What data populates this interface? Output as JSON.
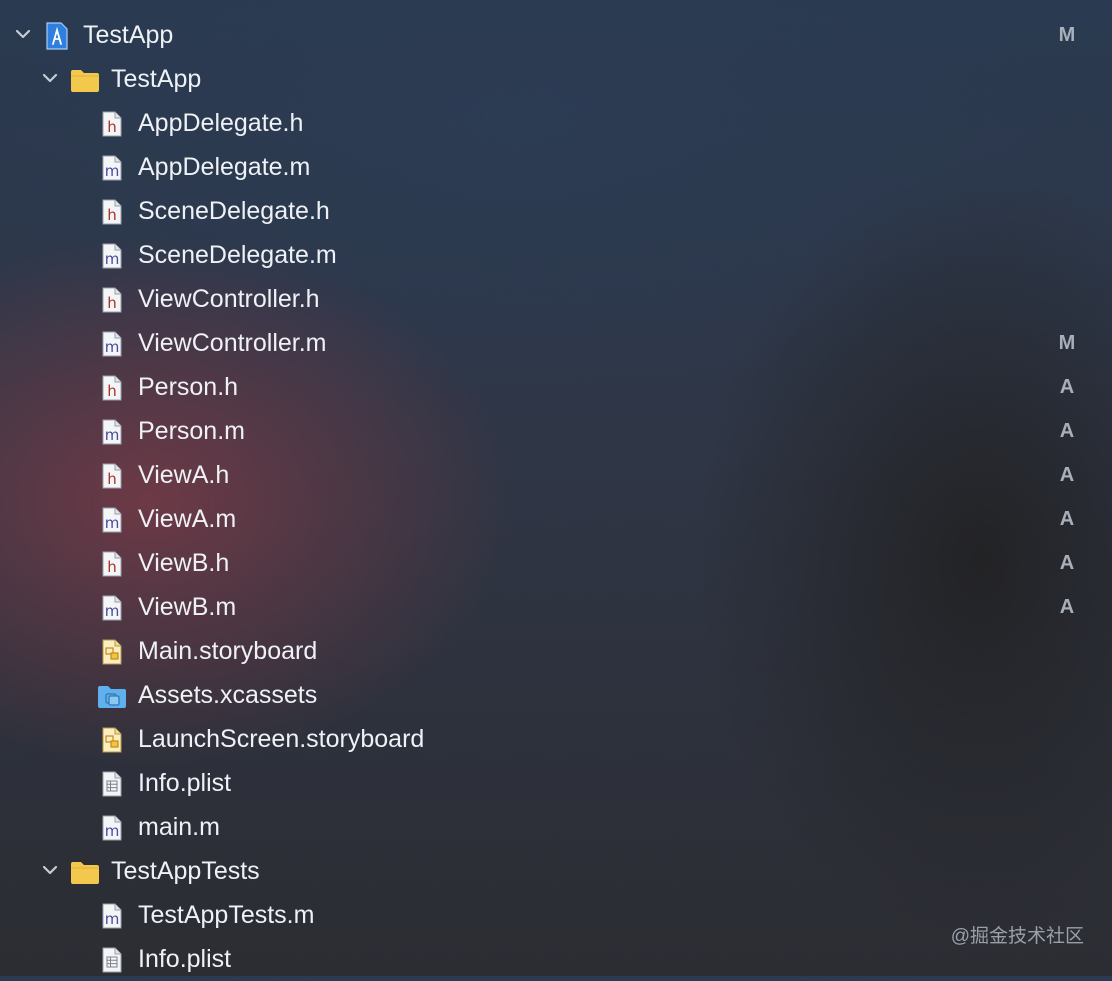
{
  "project": {
    "name": "TestApp",
    "status": "M"
  },
  "groups": [
    {
      "name": "TestApp",
      "files": [
        {
          "name": "AppDelegate.h",
          "icon": "h-header-file-icon",
          "status": ""
        },
        {
          "name": "AppDelegate.m",
          "icon": "m-source-file-icon",
          "status": ""
        },
        {
          "name": "SceneDelegate.h",
          "icon": "h-header-file-icon",
          "status": ""
        },
        {
          "name": "SceneDelegate.m",
          "icon": "m-source-file-icon",
          "status": ""
        },
        {
          "name": "ViewController.h",
          "icon": "h-header-file-icon",
          "status": ""
        },
        {
          "name": "ViewController.m",
          "icon": "m-source-file-icon",
          "status": "M"
        },
        {
          "name": "Person.h",
          "icon": "h-header-file-icon",
          "status": "A"
        },
        {
          "name": "Person.m",
          "icon": "m-source-file-icon",
          "status": "A"
        },
        {
          "name": "ViewA.h",
          "icon": "h-header-file-icon",
          "status": "A"
        },
        {
          "name": "ViewA.m",
          "icon": "m-source-file-icon",
          "status": "A"
        },
        {
          "name": "ViewB.h",
          "icon": "h-header-file-icon",
          "status": "A"
        },
        {
          "name": "ViewB.m",
          "icon": "m-source-file-icon",
          "status": "A"
        },
        {
          "name": "Main.storyboard",
          "icon": "storyboard-file-icon",
          "status": ""
        },
        {
          "name": "Assets.xcassets",
          "icon": "asset-catalog-folder-icon",
          "status": ""
        },
        {
          "name": "LaunchScreen.storyboard",
          "icon": "storyboard-file-icon",
          "status": ""
        },
        {
          "name": "Info.plist",
          "icon": "plist-file-icon",
          "status": ""
        },
        {
          "name": "main.m",
          "icon": "m-source-file-icon",
          "status": ""
        }
      ]
    },
    {
      "name": "TestAppTests",
      "files": [
        {
          "name": "TestAppTests.m",
          "icon": "m-source-file-icon",
          "status": ""
        },
        {
          "name": "Info.plist",
          "icon": "plist-file-icon",
          "status": ""
        }
      ]
    }
  ],
  "watermark": "@掘金技术社区",
  "colors": {
    "header_letter": "#a8322a",
    "source_letter": "#4a4aa0",
    "folder": "#f2c94c",
    "asset_folder": "#5fb0ec",
    "status": "#a9afb9"
  }
}
